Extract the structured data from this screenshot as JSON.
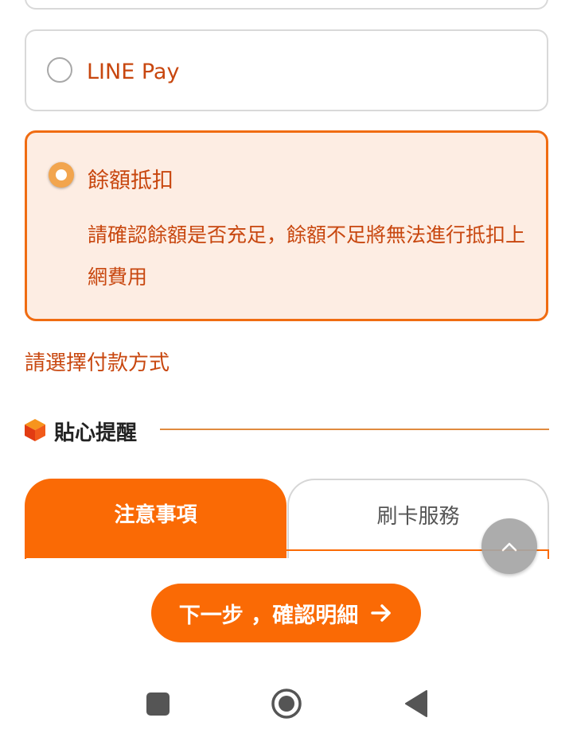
{
  "payment_options": {
    "line_pay": {
      "label": "LINE Pay",
      "selected": false
    },
    "balance": {
      "label": "餘額抵扣",
      "selected": true,
      "note": "請確認餘額是否充足，餘額不足將無法進行抵扣上網費用"
    }
  },
  "prompt": "請選擇付款方式",
  "reminder": {
    "title": "貼心提醒"
  },
  "tabs": [
    {
      "label": "注意事項",
      "active": true
    },
    {
      "label": "刷卡服務",
      "active": false
    }
  ],
  "next_button": {
    "label": "下一步 ，確認明細"
  },
  "icons": {
    "scroll_top": "chevron-up-icon",
    "next_arrow": "arrow-right-icon",
    "reminder": "hexagon-cube-icon",
    "nav": [
      "square-icon",
      "circle-icon",
      "triangle-back-icon"
    ]
  },
  "colors": {
    "accent": "#fa6a05",
    "text_accent": "#c8470f",
    "selected_bg": "#fdede3"
  }
}
